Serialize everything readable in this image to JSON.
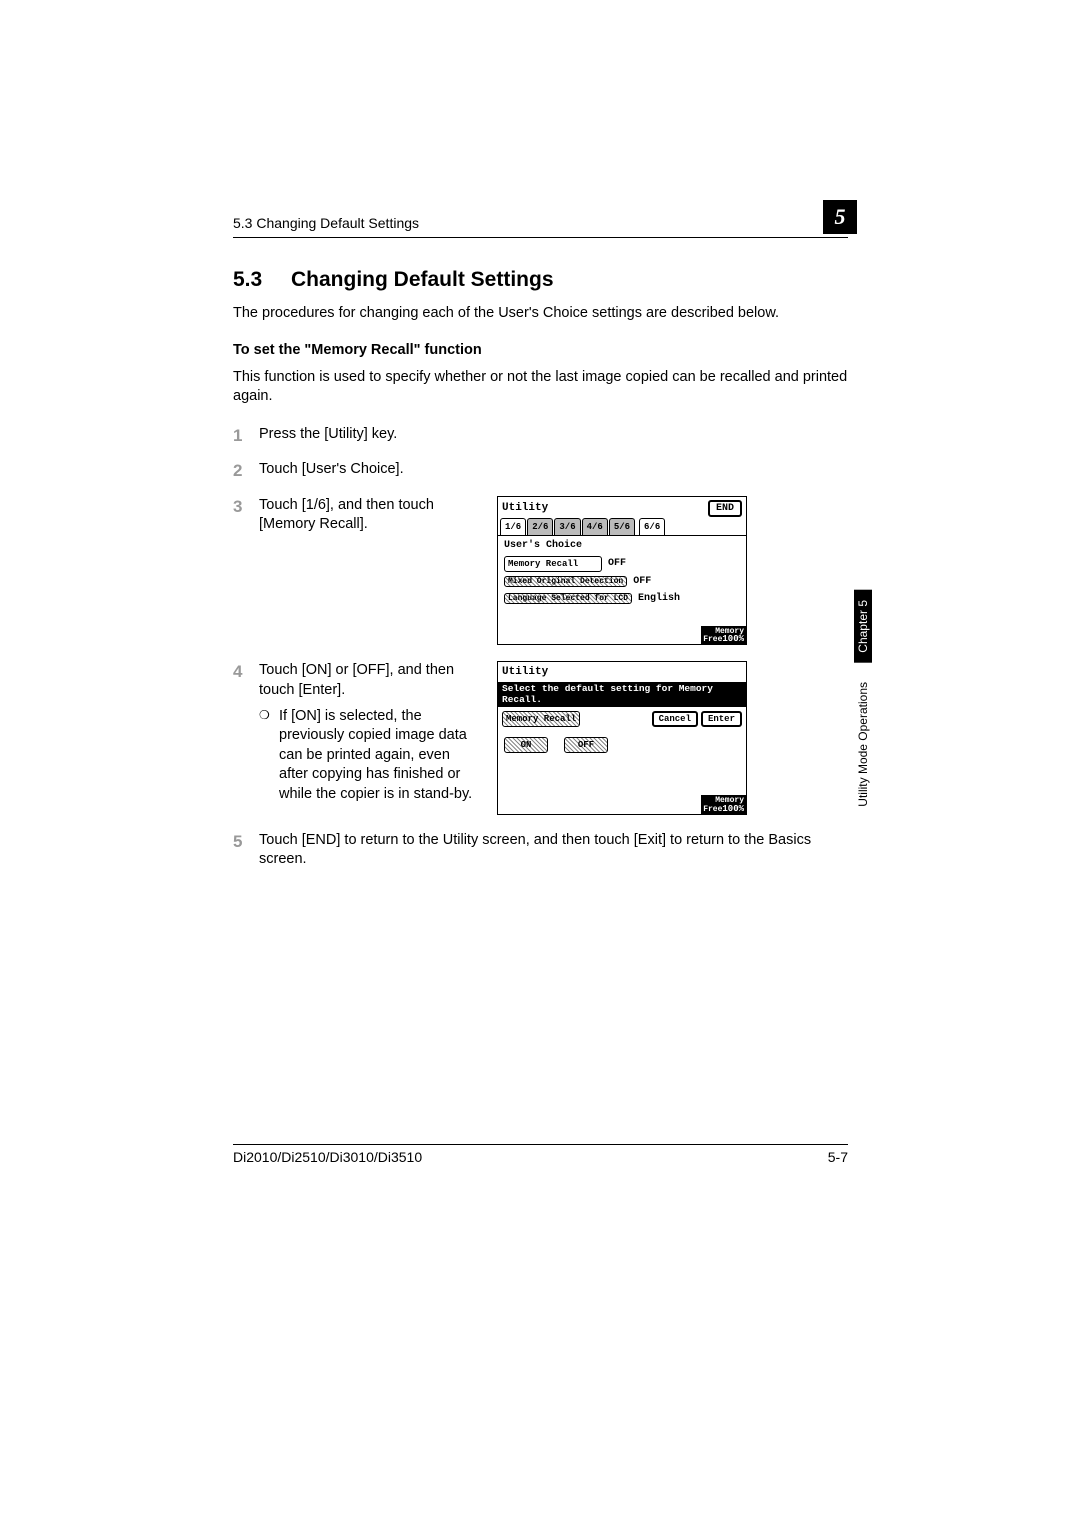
{
  "header": {
    "running": "5.3 Changing Default Settings",
    "chapter_number": "5"
  },
  "section": {
    "number": "5.3",
    "title": "Changing Default Settings",
    "intro": "The procedures for changing each of the User's Choice settings are described below.",
    "sub_heading": "To set the \"Memory Recall\" function",
    "sub_intro": "This function is used to specify whether or not the last image copied can be recalled and printed again."
  },
  "steps": {
    "s1": {
      "num": "1",
      "text": "Press the [Utility] key."
    },
    "s2": {
      "num": "2",
      "text": "Touch [User's Choice]."
    },
    "s3": {
      "num": "3",
      "text": "Touch [1/6], and then touch [Memory Recall]."
    },
    "s4": {
      "num": "4",
      "text": "Touch [ON] or [OFF], and then touch [Enter].",
      "sub": "If [ON] is selected, the previously copied image data can be printed again, even after copying has finished or while the copier is in stand-by."
    },
    "s5": {
      "num": "5",
      "text": "Touch [END] to return to the Utility screen, and then touch [Exit] to return to the Basics screen."
    }
  },
  "lcd1": {
    "title": "Utility",
    "end": "END",
    "tabs": [
      "1/6",
      "2/6",
      "3/6",
      "4/6",
      "5/6",
      "6/6"
    ],
    "subtitle": "User's Choice",
    "rows": [
      {
        "label": "Memory Recall",
        "value": "OFF"
      },
      {
        "label": "Mixed Original\nDetection",
        "value": "OFF"
      },
      {
        "label": "Language Selected\nfor LCD",
        "value": "English"
      }
    ],
    "mem_label": "Memory\nFree",
    "mem_val": "100%"
  },
  "lcd2": {
    "title": "Utility",
    "message": "Select the default setting for Memory Recall.",
    "label": "Memory Recall",
    "cancel": "Cancel",
    "enter": "Enter",
    "on": "ON",
    "off": "OFF",
    "mem_label": "Memory\nFree",
    "mem_val": "100%"
  },
  "sidetab": {
    "black": "Chapter 5",
    "white": "Utility Mode Operations"
  },
  "footer": {
    "left": "Di2010/Di2510/Di3010/Di3510",
    "right": "5-7"
  }
}
